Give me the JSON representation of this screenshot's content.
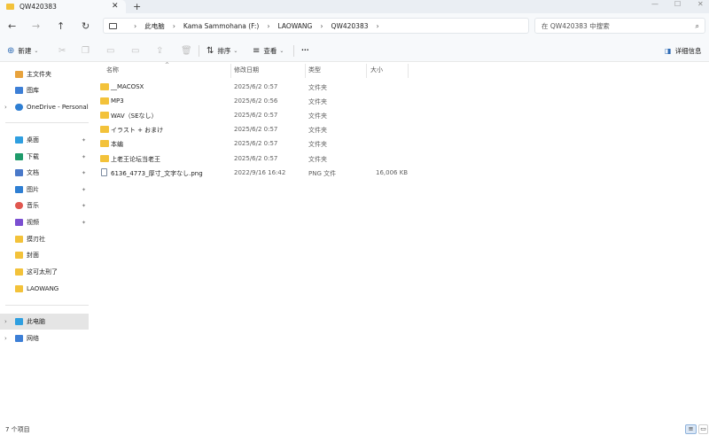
{
  "window": {
    "tab_title": "QW420383",
    "tab_close": "✕",
    "new_tab": "+",
    "minimize": "—",
    "maximize": "☐",
    "close": "✕"
  },
  "nav": {
    "back": "←",
    "forward": "→",
    "up": "↑",
    "refresh": "↻"
  },
  "address": {
    "breadcrumbs": [
      "此电脑",
      "Kama Sammohana (F:)",
      "LAOWANG",
      "QW420383"
    ],
    "separator": "›"
  },
  "search": {
    "placeholder": "在 QW420383 中搜索",
    "icon": "search-icon"
  },
  "commandbar": {
    "new_label": "新建",
    "sort_label": "排序",
    "view_label": "查看",
    "more_label": "···",
    "details_label": "详细信息"
  },
  "sidebar": {
    "items": [
      {
        "label": "主文件夹",
        "icon": "home-icon",
        "color": "#e8a33d"
      },
      {
        "label": "图库",
        "icon": "gallery-icon",
        "color": "#3d7fd6"
      },
      {
        "label": "OneDrive - Personal",
        "icon": "cloud-icon",
        "color": "#2f7fd3"
      },
      {
        "label": "桌面",
        "icon": "desktop-icon",
        "color": "#2f9fe0"
      },
      {
        "label": "下载",
        "icon": "download-icon",
        "color": "#1f9b6b"
      },
      {
        "label": "文档",
        "icon": "document-icon",
        "color": "#4a79c9"
      },
      {
        "label": "图片",
        "icon": "pictures-icon",
        "color": "#2f7fd3"
      },
      {
        "label": "音乐",
        "icon": "music-icon",
        "color": "#e0574f"
      },
      {
        "label": "视频",
        "icon": "video-icon",
        "color": "#7b4fd1"
      },
      {
        "label": "摸刃社",
        "icon": "folder-icon",
        "color": "#f3c23a"
      },
      {
        "label": "封面",
        "icon": "folder-icon",
        "color": "#f3c23a"
      },
      {
        "label": "这可太刑了",
        "icon": "folder-icon",
        "color": "#f3c23a"
      },
      {
        "label": "LAOWANG",
        "icon": "folder-icon",
        "color": "#f3c23a"
      },
      {
        "label": "此电脑",
        "icon": "pc-icon",
        "color": "#2f9fe0"
      },
      {
        "label": "网络",
        "icon": "network-icon",
        "color": "#3d7fd6"
      }
    ],
    "pin_glyph": "📌"
  },
  "table": {
    "columns": [
      "名称",
      "修改日期",
      "类型",
      "大小"
    ],
    "rows": [
      {
        "name": "__MACOSX",
        "date": "2025/6/2 0:57",
        "type": "文件夹",
        "size": "",
        "kind": "folder"
      },
      {
        "name": "MP3",
        "date": "2025/6/2 0:56",
        "type": "文件夹",
        "size": "",
        "kind": "folder"
      },
      {
        "name": "WAV（SEなし）",
        "date": "2025/6/2 0:57",
        "type": "文件夹",
        "size": "",
        "kind": "folder"
      },
      {
        "name": "イラスト + おまけ",
        "date": "2025/6/2 0:57",
        "type": "文件夹",
        "size": "",
        "kind": "folder"
      },
      {
        "name": "本编",
        "date": "2025/6/2 0:57",
        "type": "文件夹",
        "size": "",
        "kind": "folder"
      },
      {
        "name": "上老王论坛当老王",
        "date": "2025/6/2 0:57",
        "type": "文件夹",
        "size": "",
        "kind": "folder"
      },
      {
        "name": "6136_4773_厚寸_文字なし.png",
        "date": "2022/9/16 16:42",
        "type": "PNG 文件",
        "size": "16,006 KB",
        "kind": "file"
      }
    ]
  },
  "status": {
    "item_count": "7 个项目"
  },
  "colors": {
    "accent": "#2e6bb5",
    "folder": "#f3c23a",
    "chrome_bg": "#f7f9fb"
  }
}
